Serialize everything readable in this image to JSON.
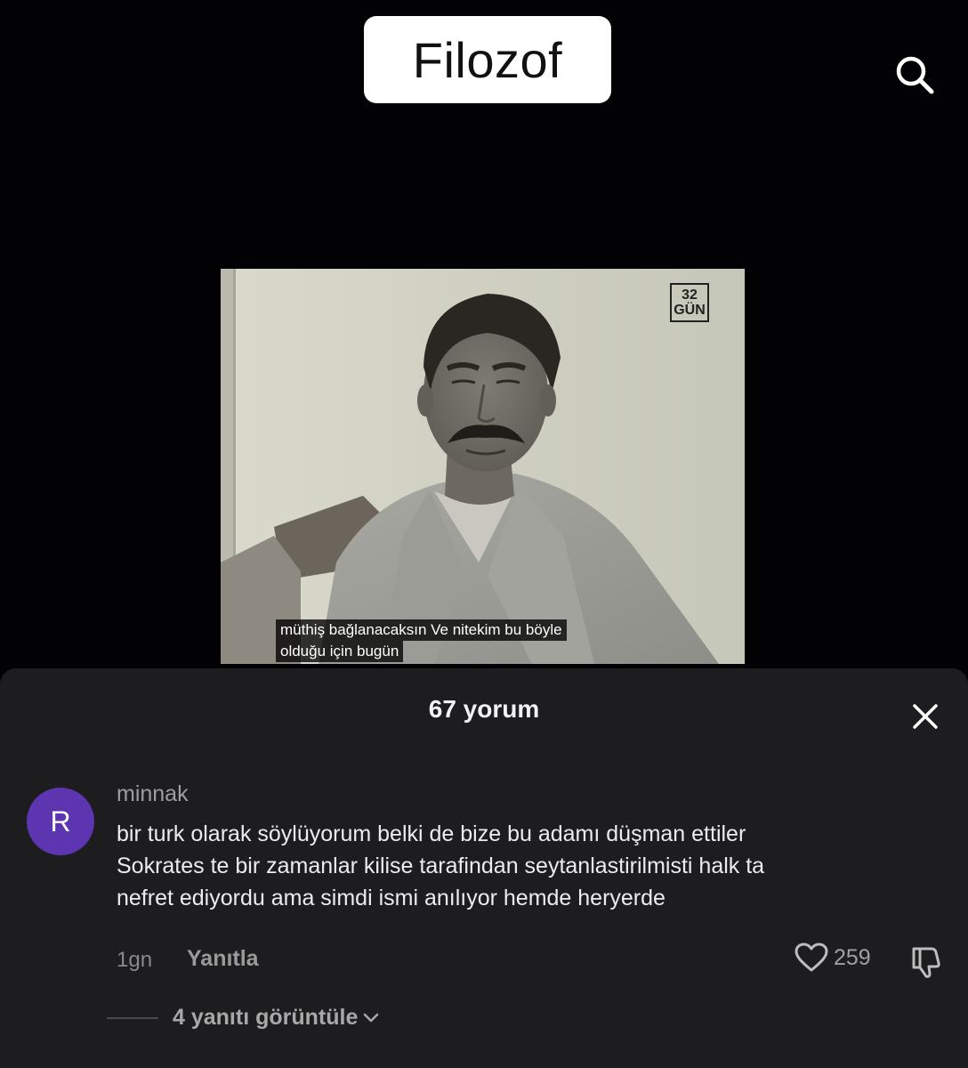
{
  "header": {
    "title": "Filozof"
  },
  "video": {
    "logo_text": "32 GÜN",
    "logo_line1": "32",
    "logo_line2": "GÜN",
    "subtitle_line1": "müthiş bağlanacaksın Ve nitekim bu böyle",
    "subtitle_line2": "olduğu için bugün"
  },
  "comments_sheet": {
    "title": "67 yorum",
    "comment": {
      "avatar_initial": "R",
      "avatar_color": "#5e35b1",
      "username": "minnak",
      "text_lines": [
        "bir turk olarak söylüyorum belki de bize bu adamı düşman ettiler",
        "Sokrates te bir zamanlar kilise tarafindan seytanlastirilmisti halk ta",
        "nefret ediyordu ama simdi ismi anılıyor hemde heryerde"
      ],
      "time": "1gn",
      "reply_label": "Yanıtla",
      "like_count": "259",
      "view_replies_label": "4 yanıtı görüntüle"
    }
  },
  "icons": {
    "search": "search-icon",
    "close": "close-icon",
    "heart": "heart-icon",
    "dislike": "dislike-icon",
    "chevron": "chevron-down-icon"
  }
}
